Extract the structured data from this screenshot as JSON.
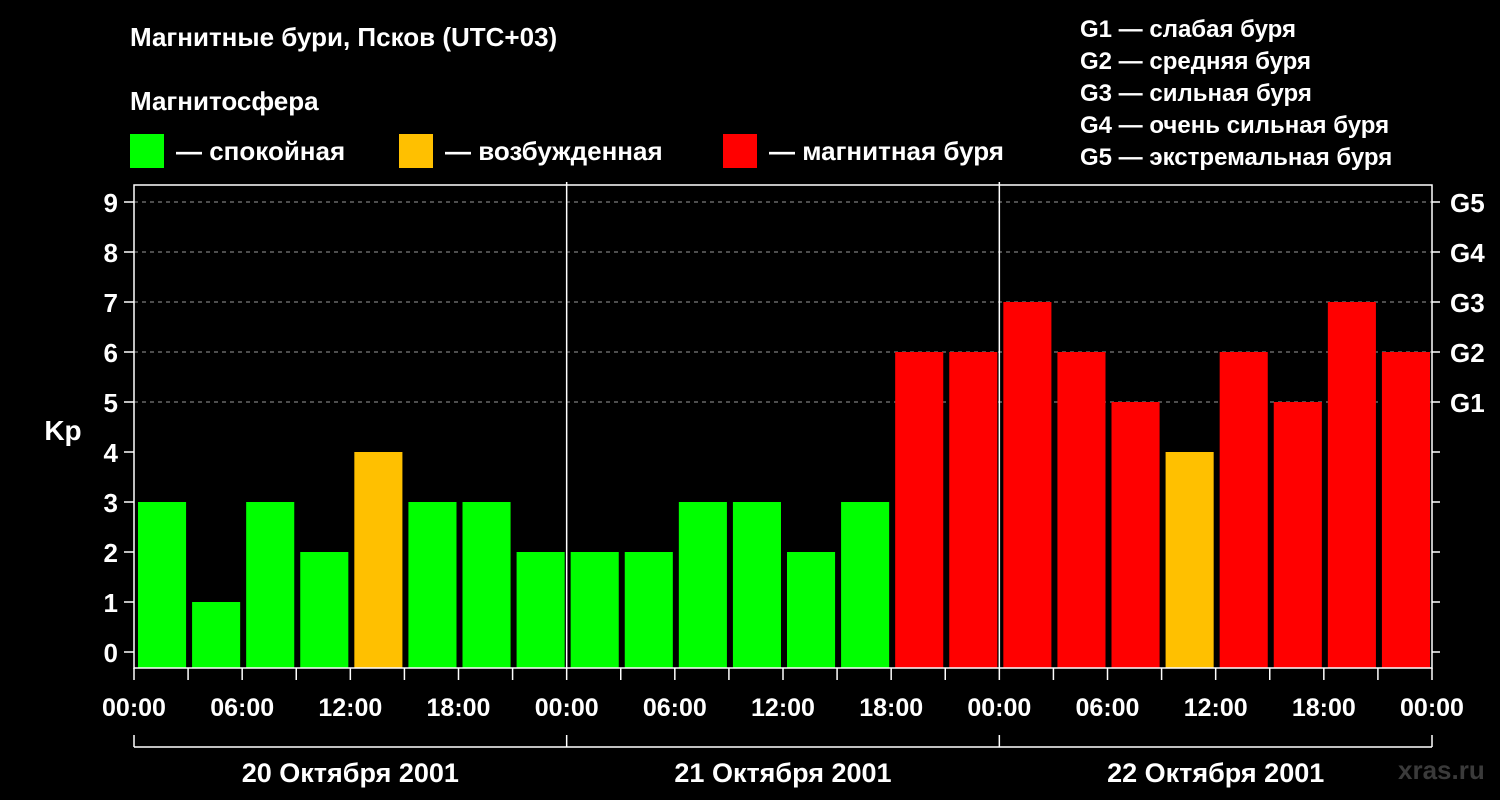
{
  "title": "Магнитные бури, Псков (UTC+03)",
  "subtitle": "Магнитосфера",
  "legend": [
    {
      "label": "— спокойная",
      "color": "#00ff00"
    },
    {
      "label": "— возбужденная",
      "color": "#ffc000"
    },
    {
      "label": "— магнитная буря",
      "color": "#ff0000"
    }
  ],
  "g_scale": [
    "G1 — слабая буря",
    "G2 — средняя буря",
    "G3 — сильная буря",
    "G4 — очень сильная буря",
    "G5 — экстремальная буря"
  ],
  "watermark": "xras.ru",
  "chart_data": {
    "type": "bar",
    "ylabel": "Kp",
    "ylim": [
      0,
      9
    ],
    "yticks": [
      "0",
      "1",
      "2",
      "3",
      "4",
      "5",
      "6",
      "7",
      "8",
      "9"
    ],
    "right_ticks": [
      {
        "kp": 5,
        "label": "G1"
      },
      {
        "kp": 6,
        "label": "G2"
      },
      {
        "kp": 7,
        "label": "G3"
      },
      {
        "kp": 8,
        "label": "G4"
      },
      {
        "kp": 9,
        "label": "G5"
      }
    ],
    "xtick_labels": [
      "00:00",
      "06:00",
      "12:00",
      "18:00",
      "00:00",
      "06:00",
      "12:00",
      "18:00",
      "00:00",
      "06:00",
      "12:00",
      "18:00",
      "00:00"
    ],
    "days": [
      "20 Октября 2001",
      "21 Октября 2001",
      "22 Октября 2001"
    ],
    "values": [
      3,
      1,
      3,
      2,
      4,
      3,
      3,
      2,
      2,
      2,
      3,
      3,
      2,
      3,
      6,
      6,
      7,
      6,
      5,
      4,
      6,
      5,
      7,
      6
    ],
    "colors": [
      "#00ff00",
      "#00ff00",
      "#00ff00",
      "#00ff00",
      "#ffc000",
      "#00ff00",
      "#00ff00",
      "#00ff00",
      "#00ff00",
      "#00ff00",
      "#00ff00",
      "#00ff00",
      "#00ff00",
      "#00ff00",
      "#ff0000",
      "#ff0000",
      "#ff0000",
      "#ff0000",
      "#ff0000",
      "#ffc000",
      "#ff0000",
      "#ff0000",
      "#ff0000",
      "#ff0000"
    ],
    "grid": "dashed at Kp 5–9"
  }
}
